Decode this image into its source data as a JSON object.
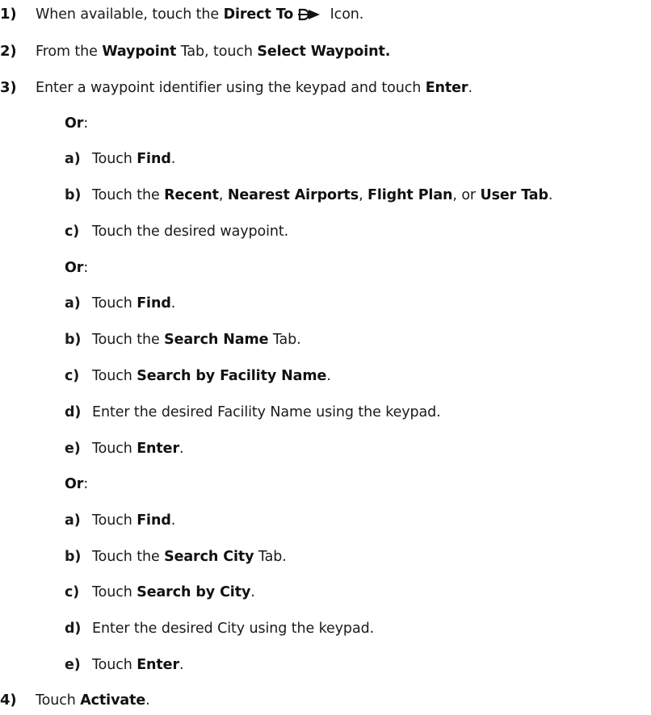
{
  "steps": [
    {
      "num": "1)",
      "parts": [
        "When available, touch the ",
        "Direct To",
        "",
        " Icon."
      ],
      "icon": "direct-to-icon"
    },
    {
      "num": "2)",
      "parts": [
        "From the ",
        "Waypoint",
        " Tab, touch ",
        "Select Waypoint."
      ]
    },
    {
      "num": "3)",
      "parts": [
        "Enter a waypoint identifier using the keypad and touch ",
        "Enter",
        "."
      ]
    },
    {
      "num": "4)",
      "parts": [
        "Touch ",
        "Activate",
        "."
      ]
    }
  ],
  "or_label": "Or",
  "or_colon": ":",
  "group1": [
    {
      "letter": "a)",
      "parts": [
        "Touch ",
        "Find",
        "."
      ]
    },
    {
      "letter": "b)",
      "parts": [
        "Touch the ",
        "Recent",
        ", ",
        "Nearest Airports",
        ", ",
        "Flight Plan",
        ", or ",
        "User Tab",
        "."
      ]
    },
    {
      "letter": "c)",
      "parts": [
        "Touch the desired waypoint."
      ]
    }
  ],
  "group2": [
    {
      "letter": "a)",
      "parts": [
        "Touch ",
        "Find",
        "."
      ]
    },
    {
      "letter": "b)",
      "parts": [
        "Touch the ",
        "Search Name",
        " Tab."
      ]
    },
    {
      "letter": "c)",
      "parts": [
        "Touch ",
        "Search by Facility Name",
        "."
      ]
    },
    {
      "letter": "d)",
      "parts": [
        "Enter the desired Facility Name using the keypad."
      ]
    },
    {
      "letter": "e)",
      "parts": [
        "Touch ",
        "Enter",
        "."
      ]
    }
  ],
  "group3": [
    {
      "letter": "a)",
      "parts": [
        "Touch ",
        "Find",
        "."
      ]
    },
    {
      "letter": "b)",
      "parts": [
        "Touch the ",
        "Search City",
        " Tab."
      ]
    },
    {
      "letter": "c)",
      "parts": [
        "Touch ",
        "Search by City",
        "."
      ]
    },
    {
      "letter": "d)",
      "parts": [
        "Enter the desired City using the keypad."
      ]
    },
    {
      "letter": "e)",
      "parts": [
        "Touch ",
        "Enter",
        "."
      ]
    }
  ]
}
